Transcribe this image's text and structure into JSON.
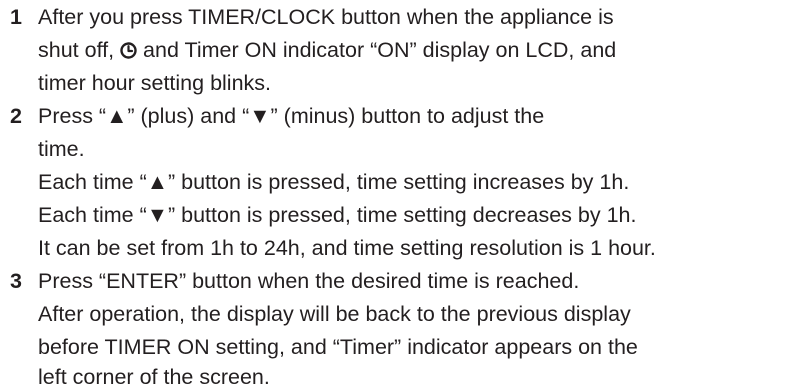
{
  "steps": [
    {
      "number": "1",
      "lines": {
        "l1": "After you press TIMER/CLOCK button when the appliance is",
        "l2_after_icon": " and Timer ON indicator “ON” display on LCD, and",
        "l2_before_icon": "shut off, ",
        "l3": "timer hour setting blinks."
      },
      "icon": "timer-clock-icon"
    },
    {
      "number": "2",
      "lines": {
        "l1": "Press “▲” (plus) and “▼” (minus) button to adjust the",
        "l2": "time.",
        "l3": "Each time “▲” button is pressed, time setting increases by 1h.",
        "l4": "Each time “▼” button is pressed, time setting decreases by 1h.",
        "l5": "It can be set from 1h to 24h, and time setting resolution is 1 hour."
      }
    },
    {
      "number": "3",
      "lines": {
        "l1": "Press “ENTER” button when the desired time is reached.",
        "l2": "After operation, the display will be back to the previous display",
        "l3": "before TIMER ON setting, and “Timer” indicator appears on the",
        "l4": "left corner of the screen."
      }
    }
  ]
}
